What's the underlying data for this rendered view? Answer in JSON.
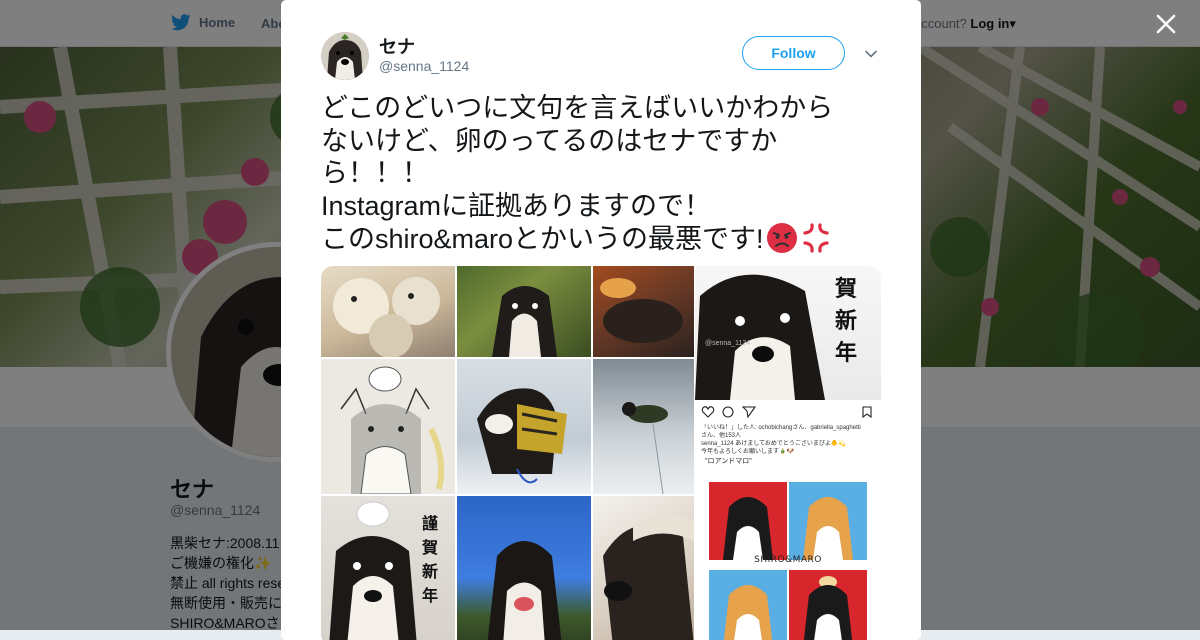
{
  "nav": {
    "home_label": "Home",
    "about_label": "Abo",
    "account_prompt": "account?",
    "login_label": "Log in",
    "login_caret": "▾"
  },
  "profile": {
    "name": "セナ",
    "handle": "@senna_1124",
    "bio_lines": [
      "黒柴セナ:2008.11",
      "ご機嫌の権化✨",
      "禁止 all rights rese",
      "無断使用・販売に",
      "SHIRO&MAROさ"
    ]
  },
  "tweet": {
    "author_name": "セナ",
    "author_handle": "@senna_1124",
    "follow_label": "Follow",
    "text_lines": [
      "どこのどいつに文句を言えばいいかわから",
      "ないけど、卵のってるのはセナですか",
      "ら！！！",
      "Instagramに証拠ありますので！",
      "このshiro&maroとかいうの最悪です!"
    ],
    "emoji_names": [
      "angry-face-icon",
      "anger-symbol-icon"
    ]
  },
  "media": {
    "kanji_large": [
      "賀",
      "新",
      "年"
    ],
    "kanji_small": [
      "謹",
      "賀",
      "新",
      "年"
    ],
    "watermark": "@senna_1124",
    "ig_lines": [
      "「いいね！」した人: ochobichangさん、gabriella_spaghetti",
      "さん、他153人",
      "senna_1124 あけましておめでとうございまぴよ🐥💫",
      "今年もよろしくお願いします🎍🐶"
    ],
    "ig_caption": "\"ロアンドマロ\"",
    "poster_label": "SHIRO&MARO"
  },
  "colors": {
    "twitter_blue": "#1da1f2",
    "text_primary": "#14171a",
    "text_secondary": "#657786",
    "overlay": "rgba(0,0,0,0.5)"
  }
}
